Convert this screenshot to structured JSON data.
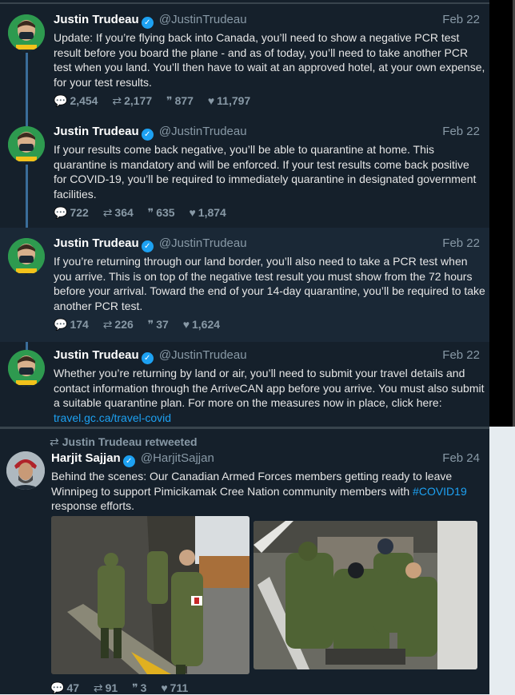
{
  "tweets": [
    {
      "name": "Justin Trudeau",
      "handle": "@JustinTrudeau",
      "date": "Feb 22",
      "text": "Update: If you’re flying back into Canada, you’ll need to show a negative PCR test result before you board the plane - and as of today, you’ll need to take another PCR test when you land. You’ll then have to wait at an approved hotel, at your own expense, for your test results.",
      "stats": {
        "replies": "2,454",
        "retweets": "2,177",
        "quotes": "877",
        "likes": "11,797"
      }
    },
    {
      "name": "Justin Trudeau",
      "handle": "@JustinTrudeau",
      "date": "Feb 22",
      "text": "If your results come back negative, you’ll be able to quarantine at home. This quarantine is mandatory and will be enforced. If your test results come back positive for COVID-19, you’ll be required to immediately quarantine in designated government facilities.",
      "stats": {
        "replies": "722",
        "retweets": "364",
        "quotes": "635",
        "likes": "1,874"
      }
    },
    {
      "name": "Justin Trudeau",
      "handle": "@JustinTrudeau",
      "date": "Feb 22",
      "text": "If you’re returning through our land border, you’ll also need to take a PCR test when you arrive. This is on top of the negative test result you must show from the 72 hours before your arrival. Toward the end of your 14-day quarantine, you’ll be required to take another PCR test.",
      "stats": {
        "replies": "174",
        "retweets": "226",
        "quotes": "37",
        "likes": "1,624"
      }
    },
    {
      "name": "Justin Trudeau",
      "handle": "@JustinTrudeau",
      "date": "Feb 22",
      "text": "Whether you’re returning by land or air, you’ll need to submit your travel details and contact information through the ArriveCAN app before you arrive. You must also submit a suitable quarantine plan. For more on the measures now in place, click here: ",
      "link": "travel.gc.ca/travel-covid"
    }
  ],
  "retweet": {
    "label": "Justin Trudeau retweeted",
    "name": "Harjit Sajjan",
    "handle": "@HarjitSajjan",
    "date": "Feb 24",
    "text_before": "Behind the scenes: Our Canadian Armed Forces members getting ready to leave Winnipeg to support Pimicikamak Cree Nation community members with ",
    "hashtag": "#COVID19",
    "text_after": " response efforts.",
    "stats": {
      "replies": "47",
      "retweets": "91",
      "quotes": "3",
      "likes": "711"
    }
  },
  "icons": {
    "reply": "reply-icon",
    "retweet": "retweet-icon",
    "quote": "quote-icon",
    "like": "heart-icon",
    "verified": "verified-badge-icon"
  },
  "colors": {
    "background": "#15202b",
    "accent": "#1da1f2",
    "muted": "#8899a6",
    "thread_line": "#3a6d9a"
  }
}
